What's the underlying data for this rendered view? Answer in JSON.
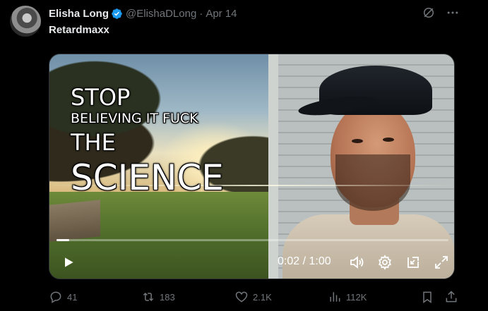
{
  "author": {
    "name": "Elisha Long",
    "handle": "@ElishaDLong",
    "separator": "·",
    "date": "Apr 14"
  },
  "tweet": {
    "text": "Retardmaxx"
  },
  "video": {
    "overlay_lines": [
      "STOP",
      "BELIEVING IT FUCK",
      "THE",
      "SCIENCE"
    ],
    "time": "0:02 / 1:00",
    "progress": 0.033
  },
  "actions": {
    "replies": "41",
    "reposts": "183",
    "likes": "2.1K",
    "views": "112K"
  },
  "colors": {
    "background": "#000000",
    "text": "#e7e9ea",
    "muted": "#71767b",
    "verified": "#1d9bf0"
  },
  "icons": [
    "verified-badge-icon",
    "grok-icon",
    "more-icon",
    "play-icon",
    "volume-icon",
    "settings-icon",
    "pip-icon",
    "fullscreen-icon",
    "reply-icon",
    "repost-icon",
    "like-icon",
    "views-icon",
    "bookmark-icon",
    "share-icon"
  ]
}
